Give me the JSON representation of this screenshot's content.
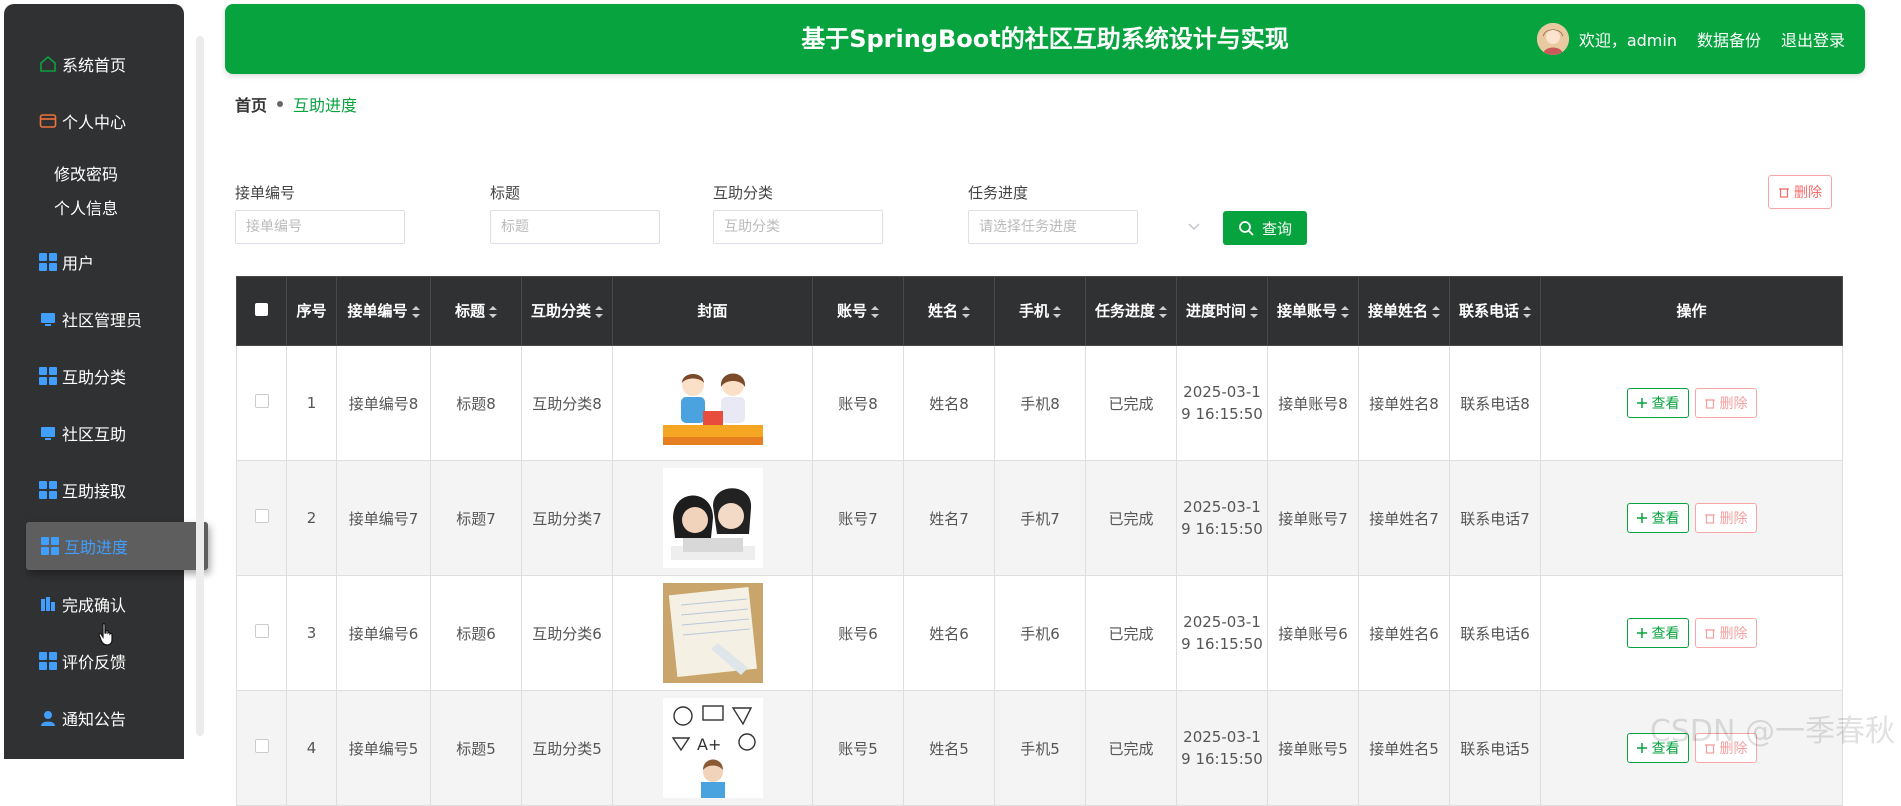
{
  "header": {
    "title": "基于SpringBoot的社区互助系统设计与实现",
    "welcome": "欢迎，admin",
    "backup": "数据备份",
    "logout": "退出登录"
  },
  "sidebar": {
    "items": [
      {
        "label": "系统首页",
        "icon": "home-icon"
      },
      {
        "label": "个人中心",
        "icon": "wallet-icon"
      },
      {
        "label": "修改密码"
      },
      {
        "label": "个人信息"
      },
      {
        "label": "用户",
        "icon": "grid-icon"
      },
      {
        "label": "社区管理员",
        "icon": "monitor-icon"
      },
      {
        "label": "互助分类",
        "icon": "grid-icon"
      },
      {
        "label": "社区互助",
        "icon": "monitor-icon"
      },
      {
        "label": "互助接取",
        "icon": "grid-icon"
      },
      {
        "label": "互助进度",
        "icon": "grid-icon"
      },
      {
        "label": "完成确认",
        "icon": "chart-icon"
      },
      {
        "label": "评价反馈",
        "icon": "grid-icon"
      },
      {
        "label": "通知公告",
        "icon": "user-icon"
      }
    ]
  },
  "breadcrumb": {
    "home": "首页",
    "current": "互助进度"
  },
  "search": {
    "fields": [
      {
        "label": "接单编号",
        "placeholder": "接单编号"
      },
      {
        "label": "标题",
        "placeholder": "标题"
      },
      {
        "label": "互助分类",
        "placeholder": "互助分类"
      },
      {
        "label": "任务进度",
        "placeholder": "请选择任务进度"
      }
    ],
    "query_label": "查询",
    "delete_label": "删除"
  },
  "table": {
    "columns": [
      "序号",
      "接单编号",
      "标题",
      "互助分类",
      "封面",
      "账号",
      "姓名",
      "手机",
      "任务进度",
      "进度时间",
      "接单账号",
      "接单姓名",
      "联系电话",
      "操作"
    ],
    "view_label": "查看",
    "delete_label": "删除",
    "rows": [
      {
        "no": "1",
        "code": "接单编号8",
        "title": "标题8",
        "category": "互助分类8",
        "account": "账号8",
        "name": "姓名8",
        "phone": "手机8",
        "progress": "已完成",
        "time": "2025-03-19 16:15:50",
        "taker_account": "接单账号8",
        "taker_name": "接单姓名8",
        "contact": "联系电话8"
      },
      {
        "no": "2",
        "code": "接单编号7",
        "title": "标题7",
        "category": "互助分类7",
        "account": "账号7",
        "name": "姓名7",
        "phone": "手机7",
        "progress": "已完成",
        "time": "2025-03-19 16:15:50",
        "taker_account": "接单账号7",
        "taker_name": "接单姓名7",
        "contact": "联系电话7"
      },
      {
        "no": "3",
        "code": "接单编号6",
        "title": "标题6",
        "category": "互助分类6",
        "account": "账号6",
        "name": "姓名6",
        "phone": "手机6",
        "progress": "已完成",
        "time": "2025-03-19 16:15:50",
        "taker_account": "接单账号6",
        "taker_name": "接单姓名6",
        "contact": "联系电话6"
      },
      {
        "no": "4",
        "code": "接单编号5",
        "title": "标题5",
        "category": "互助分类5",
        "account": "账号5",
        "name": "姓名5",
        "phone": "手机5",
        "progress": "已完成",
        "time": "2025-03-19 16:15:50",
        "taker_account": "接单账号5",
        "taker_name": "接单姓名5",
        "contact": "联系电话5"
      }
    ]
  },
  "watermark": "CSDN @一季春秋",
  "colors": {
    "primary": "#07a33f",
    "sidebar": "#303133",
    "danger": "#f56c6c",
    "active": "#409eff"
  }
}
